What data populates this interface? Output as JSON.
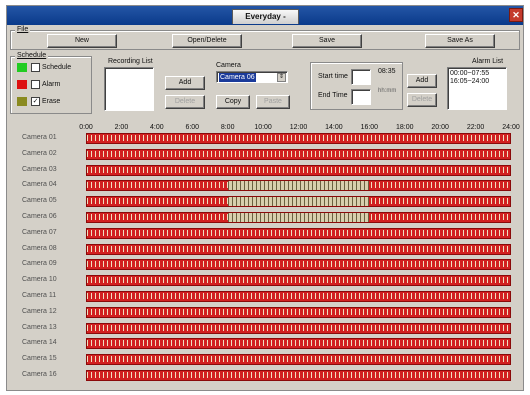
{
  "window": {
    "title": "Everyday -"
  },
  "file": {
    "legend": "File",
    "new": "New",
    "open_delete": "Open/Delete",
    "save": "Save",
    "save_as": "Save As"
  },
  "schedule": {
    "legend": "Schedule",
    "items": [
      {
        "label": "Schedule",
        "color": "#22cc22",
        "checked": false
      },
      {
        "label": "Alarm",
        "color": "#dd1111",
        "checked": false
      },
      {
        "label": "Erase",
        "color": "#8a8a20",
        "checked": true
      }
    ]
  },
  "recording": {
    "label": "Recording List",
    "add": "Add",
    "delete": "Delete"
  },
  "camera": {
    "label": "Camera",
    "selected": "Camera 06",
    "copy": "Copy",
    "paste": "Paste"
  },
  "time": {
    "start_label": "Start time",
    "start_value": "08:35",
    "end_label": "End Time",
    "end_value": "hh:mm"
  },
  "alarm": {
    "label": "Alarm List",
    "add": "Add",
    "delete": "Delete",
    "entries": [
      "00:00~07:55",
      "16:05~24:00"
    ]
  },
  "axis": [
    "0:00",
    "2:00",
    "4:00",
    "6:00",
    "8:00",
    "10:00",
    "12:00",
    "14:00",
    "16:00",
    "18:00",
    "20:00",
    "22:00",
    "24:00"
  ],
  "cameras": [
    {
      "name": "Camera 01",
      "schedule": []
    },
    {
      "name": "Camera 02",
      "schedule": []
    },
    {
      "name": "Camera 03",
      "schedule": []
    },
    {
      "name": "Camera 04",
      "schedule": [
        [
          8.0,
          16.0
        ]
      ]
    },
    {
      "name": "Camera 05",
      "schedule": [
        [
          8.0,
          16.0
        ]
      ]
    },
    {
      "name": "Camera 06",
      "schedule": [
        [
          8.0,
          16.0
        ]
      ]
    },
    {
      "name": "Camera 07",
      "schedule": []
    },
    {
      "name": "Camera 08",
      "schedule": []
    },
    {
      "name": "Camera 09",
      "schedule": []
    },
    {
      "name": "Camera 10",
      "schedule": []
    },
    {
      "name": "Camera 11",
      "schedule": []
    },
    {
      "name": "Camera 12",
      "schedule": []
    },
    {
      "name": "Camera 13",
      "schedule": []
    },
    {
      "name": "Camera 14",
      "schedule": []
    },
    {
      "name": "Camera 15",
      "schedule": []
    },
    {
      "name": "Camera 16",
      "schedule": []
    }
  ]
}
